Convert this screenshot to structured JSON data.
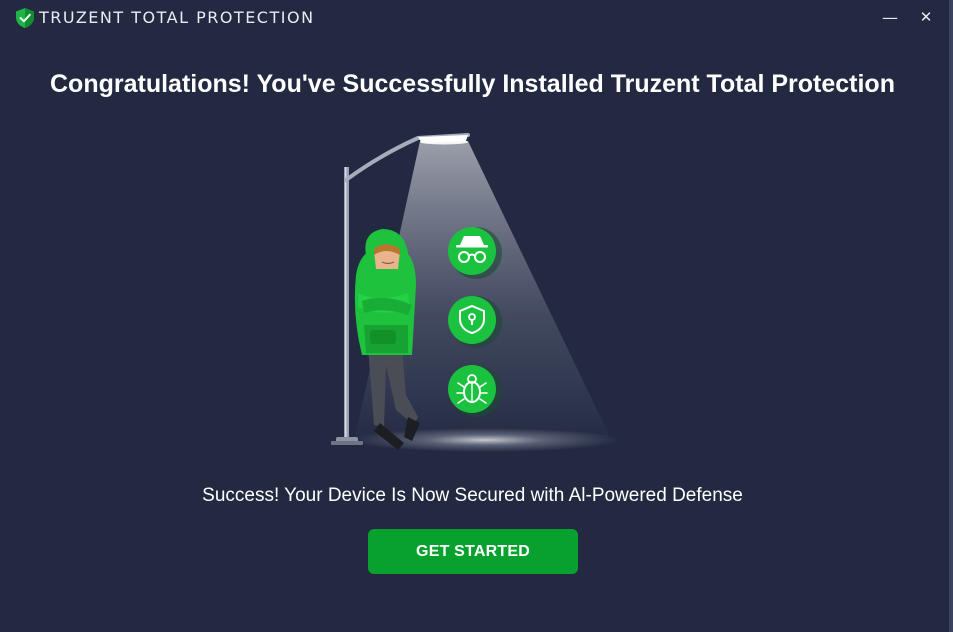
{
  "window": {
    "title": "TRUZENT TOTAL PROTECTION",
    "logo_icon": "green-shield-icon",
    "minimize_glyph": "—",
    "close_glyph": "✕"
  },
  "main": {
    "heading": "Congratulations! You've Successfully Installed Truzent Total Protection",
    "subtext": "Success! Your Device Is Now Secured with Al-Powered Defense",
    "cta_label": "GET STARTED"
  },
  "illustration": {
    "feature_icons": [
      "spy-icon",
      "shield-lock-icon",
      "bug-icon"
    ]
  },
  "colors": {
    "background": "#222941",
    "accent_green": "#08a12e",
    "icon_green": "#1bc23f"
  }
}
